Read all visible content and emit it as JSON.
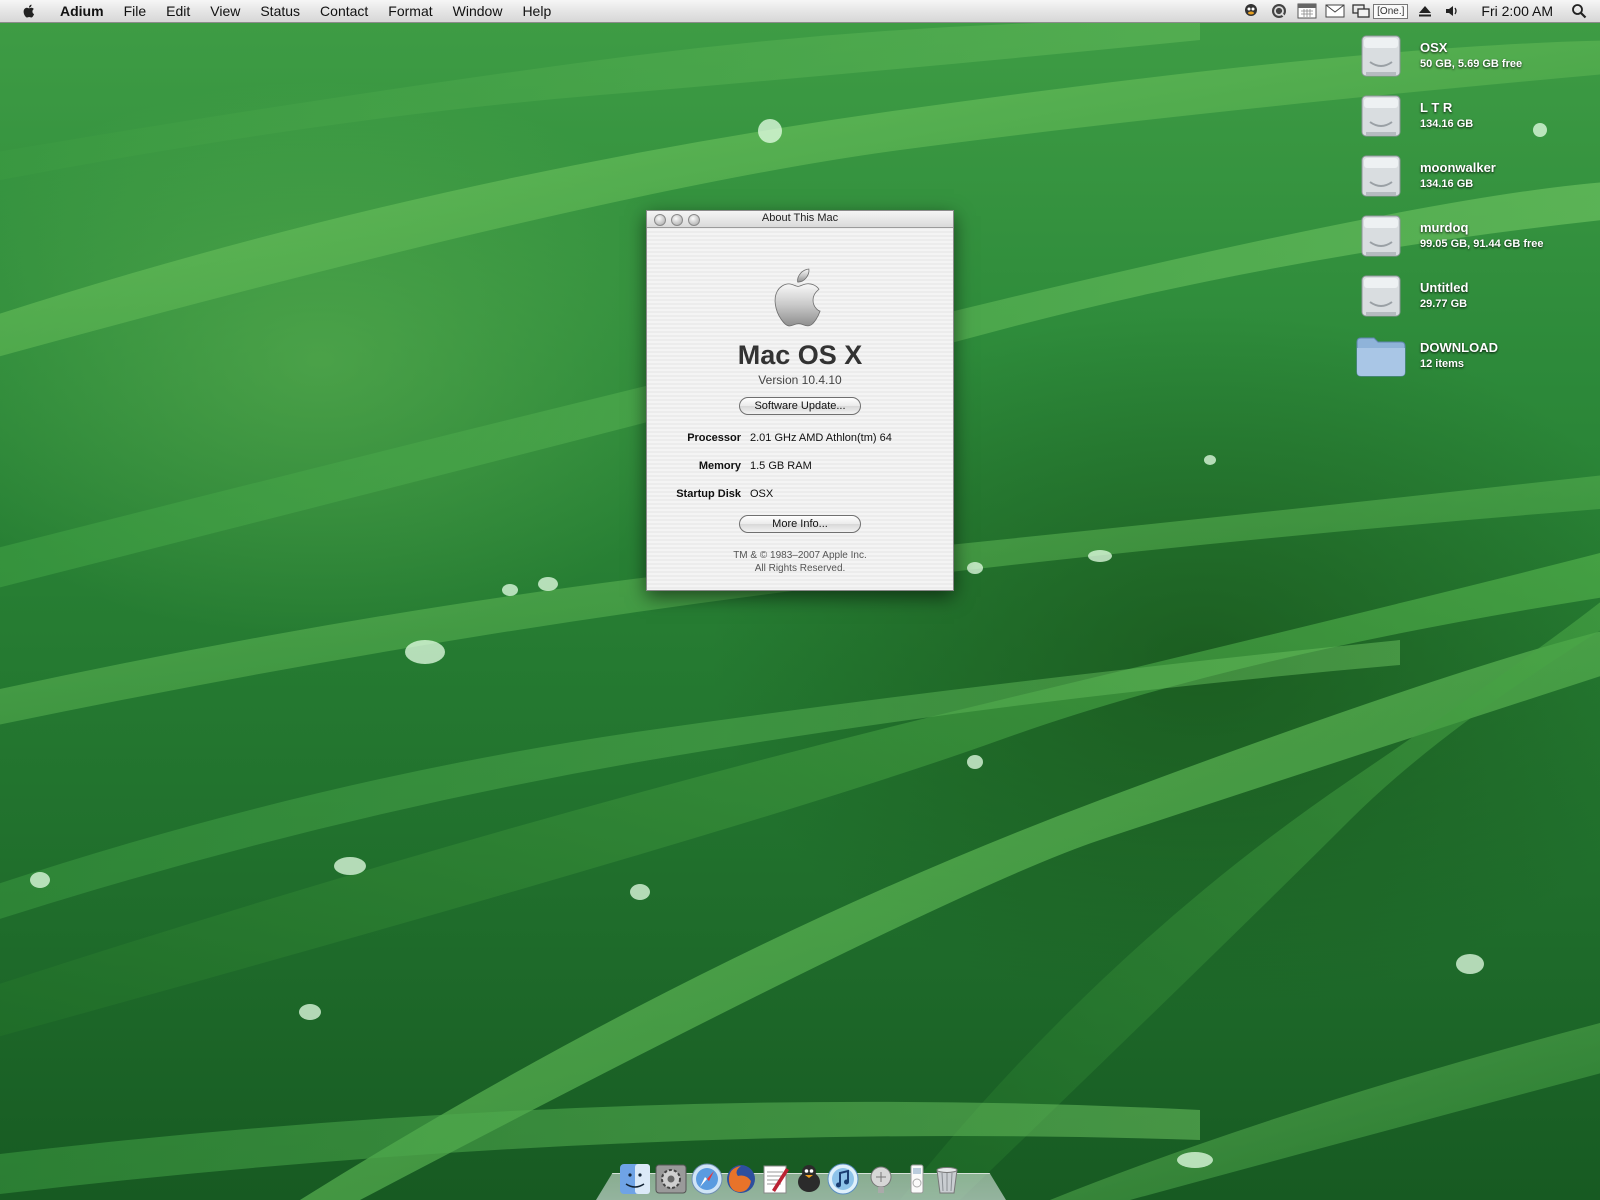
{
  "menubar": {
    "app_name": "Adium",
    "menus": [
      "File",
      "Edit",
      "View",
      "Status",
      "Contact",
      "Format",
      "Window",
      "Help"
    ],
    "status_icons": [
      "adium-duck-icon",
      "quicksilver-icon",
      "calendar-icon",
      "mail-icon",
      "spaces-icon",
      "eject-icon",
      "volume-icon"
    ],
    "spaces_label": "[One.]",
    "clock": "Fri 2:00 AM",
    "spotlight_icon": "spotlight-icon"
  },
  "desktop_icons": [
    {
      "name": "OSX",
      "info": "50 GB, 5.69 GB free",
      "icon": "hard-drive-icon"
    },
    {
      "name": "L T R",
      "info": "134.16 GB",
      "icon": "hard-drive-icon"
    },
    {
      "name": "moonwalker",
      "info": "134.16 GB",
      "icon": "hard-drive-icon"
    },
    {
      "name": "murdoq",
      "info": "99.05 GB, 91.44 GB free",
      "icon": "hard-drive-icon"
    },
    {
      "name": "Untitled",
      "info": "29.77 GB",
      "icon": "hard-drive-icon"
    },
    {
      "name": "DOWNLOAD",
      "info": "12 items",
      "icon": "folder-icon"
    }
  ],
  "about_window": {
    "title": "About This Mac",
    "os_name": "Mac OS X",
    "version": "Version 10.4.10",
    "software_update_label": "Software Update...",
    "specs": [
      {
        "label": "Processor",
        "value": "2.01 GHz AMD Athlon(tm) 64"
      },
      {
        "label": "Memory",
        "value": "1.5 GB RAM"
      },
      {
        "label": "Startup Disk",
        "value": "OSX"
      }
    ],
    "more_info_label": "More Info...",
    "copyright_line1": "TM & © 1983–2007 Apple Inc.",
    "copyright_line2": "All Rights Reserved."
  },
  "dock": {
    "items": [
      "finder-icon",
      "system-preferences-icon",
      "safari-icon",
      "firefox-icon",
      "textedit-icon",
      "adium-icon",
      "itunes-icon",
      "utility-icon",
      "ipod-icon",
      "trash-icon"
    ]
  },
  "colors": {
    "grass_light": "#56b85a",
    "grass_dark": "#1e6a2a",
    "menubar_bg": "#e4e4e4",
    "window_bg": "#ececec"
  }
}
